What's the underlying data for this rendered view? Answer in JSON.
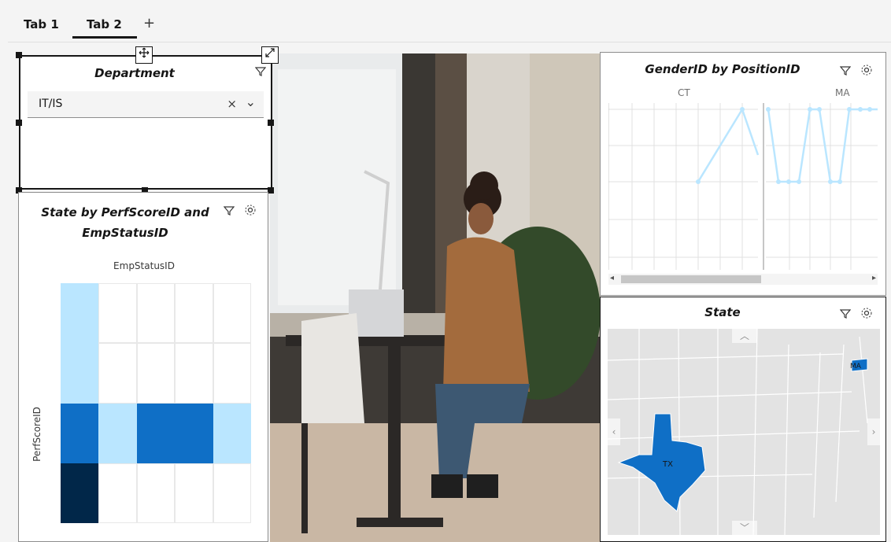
{
  "tabs": [
    {
      "label": "Tab 1",
      "active": false
    },
    {
      "label": "Tab 2",
      "active": true
    }
  ],
  "add_tab_label": "+",
  "department": {
    "title": "Department",
    "selected_value": "IT/IS",
    "clear_glyph": "×",
    "dropdown_glyph": "⌄"
  },
  "heatmap": {
    "title": "State by PerfScoreID and EmpStatusID",
    "x_axis_label": "EmpStatusID",
    "y_axis_label": "PerfScoreID",
    "rows": [
      [
        "light",
        "empty",
        "empty",
        "empty",
        "empty"
      ],
      [
        "light",
        "empty",
        "empty",
        "empty",
        "empty"
      ],
      [
        "medium",
        "light",
        "medium",
        "medium",
        "light"
      ],
      [
        "dark",
        "empty",
        "empty",
        "empty",
        "empty"
      ]
    ],
    "colors": {
      "empty": "#ffffff",
      "light": "#bae6ff",
      "medium": "#0f6fc6",
      "dark": "#012749"
    }
  },
  "line_chart": {
    "title": "GenderID by PositionID",
    "panels": [
      "CT",
      "MA"
    ],
    "line_color": "#bae6ff"
  },
  "map": {
    "title": "State",
    "labels": [
      "TX",
      "MA"
    ],
    "highlight_color": "#0f6fc6"
  },
  "icons": {
    "filter": "filter-icon",
    "settings": "settings-icon",
    "move": "move-icon",
    "expand": "expand-icon"
  }
}
